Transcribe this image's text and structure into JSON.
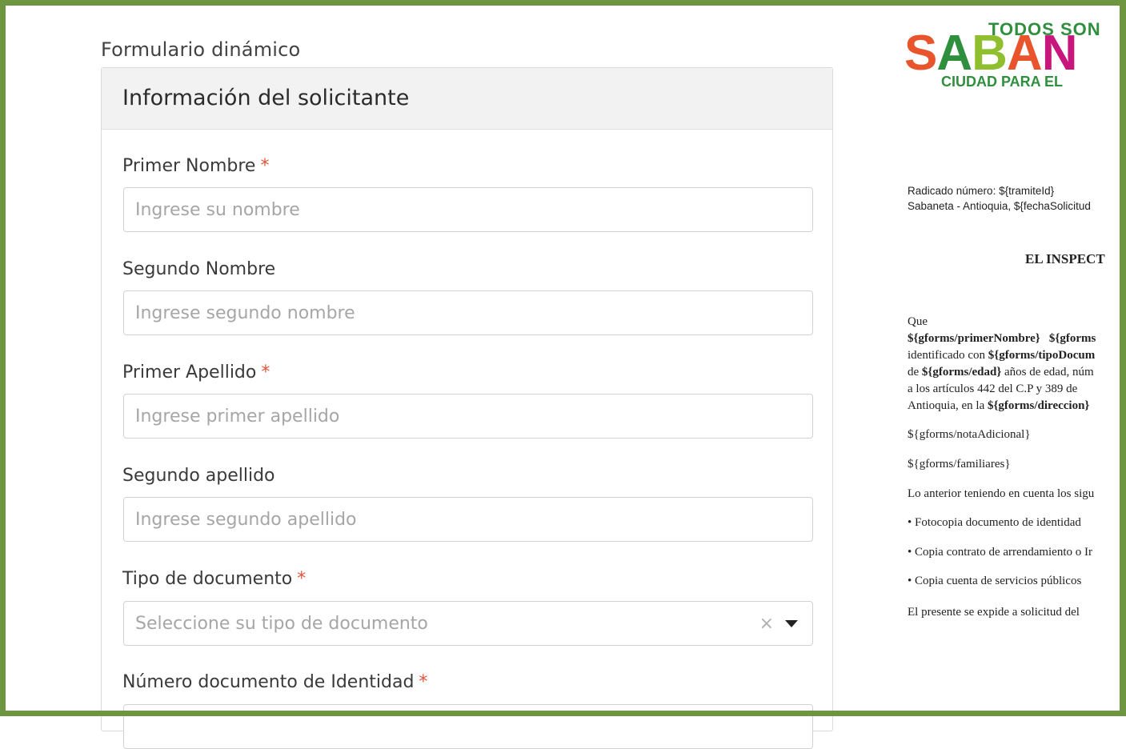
{
  "form": {
    "title": "Formulario dinámico",
    "section_title": "Información del solicitante",
    "required_mark": "*",
    "fields": {
      "primer_nombre": {
        "label": "Primer Nombre",
        "placeholder": "Ingrese su nombre"
      },
      "segundo_nombre": {
        "label": "Segundo Nombre",
        "placeholder": "Ingrese segundo nombre"
      },
      "primer_apellido": {
        "label": "Primer Apellido",
        "placeholder": "Ingrese primer apellido"
      },
      "segundo_apellido": {
        "label": "Segundo apellido",
        "placeholder": "Ingrese segundo apellido"
      },
      "tipo_documento": {
        "label": "Tipo de documento",
        "placeholder": "Seleccione su tipo de documento",
        "clear_glyph": "×"
      },
      "numero_documento": {
        "label": "Número documento de Identidad"
      }
    }
  },
  "document": {
    "logo": {
      "top": "TODOS SON",
      "big_letters": [
        "S",
        "A",
        "B",
        "A",
        "N"
      ],
      "bottom": "CIUDAD PARA EL"
    },
    "radicado": "Radicado número: ${tramiteId}",
    "ciudad_fecha": "Sabaneta - Antioquia, ${fechaSolicitud",
    "heading": "EL INSPECT",
    "que": "Que",
    "line1_a": "${gforms/primerNombre}",
    "line1_b": "${gforms",
    "line2_a": "identificado con ",
    "line2_b": "${gforms/tipoDocum",
    "line3_a": "de ",
    "line3_b": "${gforms/edad}",
    "line3_c": " años de edad, núm",
    "line4": "a los artículos 442 del C.P y 389 de",
    "line5_a": "Antioquia, en la ",
    "line5_b": "${gforms/direccion}",
    "nota": "${gforms/notaAdicional}",
    "familiares": "${gforms/familiares}",
    "anterior": "Lo anterior teniendo en cuenta los sigu",
    "bullet1": "• Fotocopia documento de identidad",
    "bullet2": "• Copia contrato de arrendamiento o Ir",
    "bullet3": "• Copia cuenta de servicios públicos",
    "presente": "El presente se expide a solicitud del"
  },
  "colors": {
    "frame": "#6e9640",
    "required": "#e0533a"
  }
}
